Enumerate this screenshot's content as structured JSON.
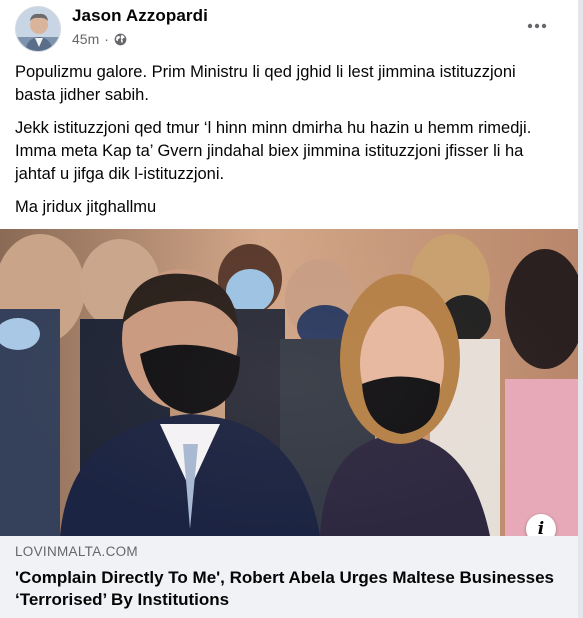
{
  "post": {
    "author_name": "Jason Azzopardi",
    "timestamp": "45m",
    "separator": "·",
    "privacy_icon": "globe-icon",
    "more_icon": "ellipsis-icon",
    "paragraphs": [
      "Populizmu galore. Prim Ministru li qed jghid li lest jimmina istituzzjoni basta jidher sabih.",
      "Jekk istituzzjoni qed tmur ‘l hinn minn dmirha hu hazin u hemm rimedji. Imma meta Kap ta’ Gvern jindahal biex jimmina istituzzjoni jfisser li ha jahtaf u jifga dik l-istituzzjoni.",
      "Ma jridux jitghallmu"
    ]
  },
  "link_preview": {
    "info_label": "i",
    "domain": "LOVINMALTA.COM",
    "headline": "'Complain Directly To Me', Robert Abela Urges Maltese Businesses ‘Terrorised’ By Institutions"
  },
  "colors": {
    "text": "#050505",
    "secondary": "#65676b",
    "link_bg": "#f0f2f5"
  }
}
